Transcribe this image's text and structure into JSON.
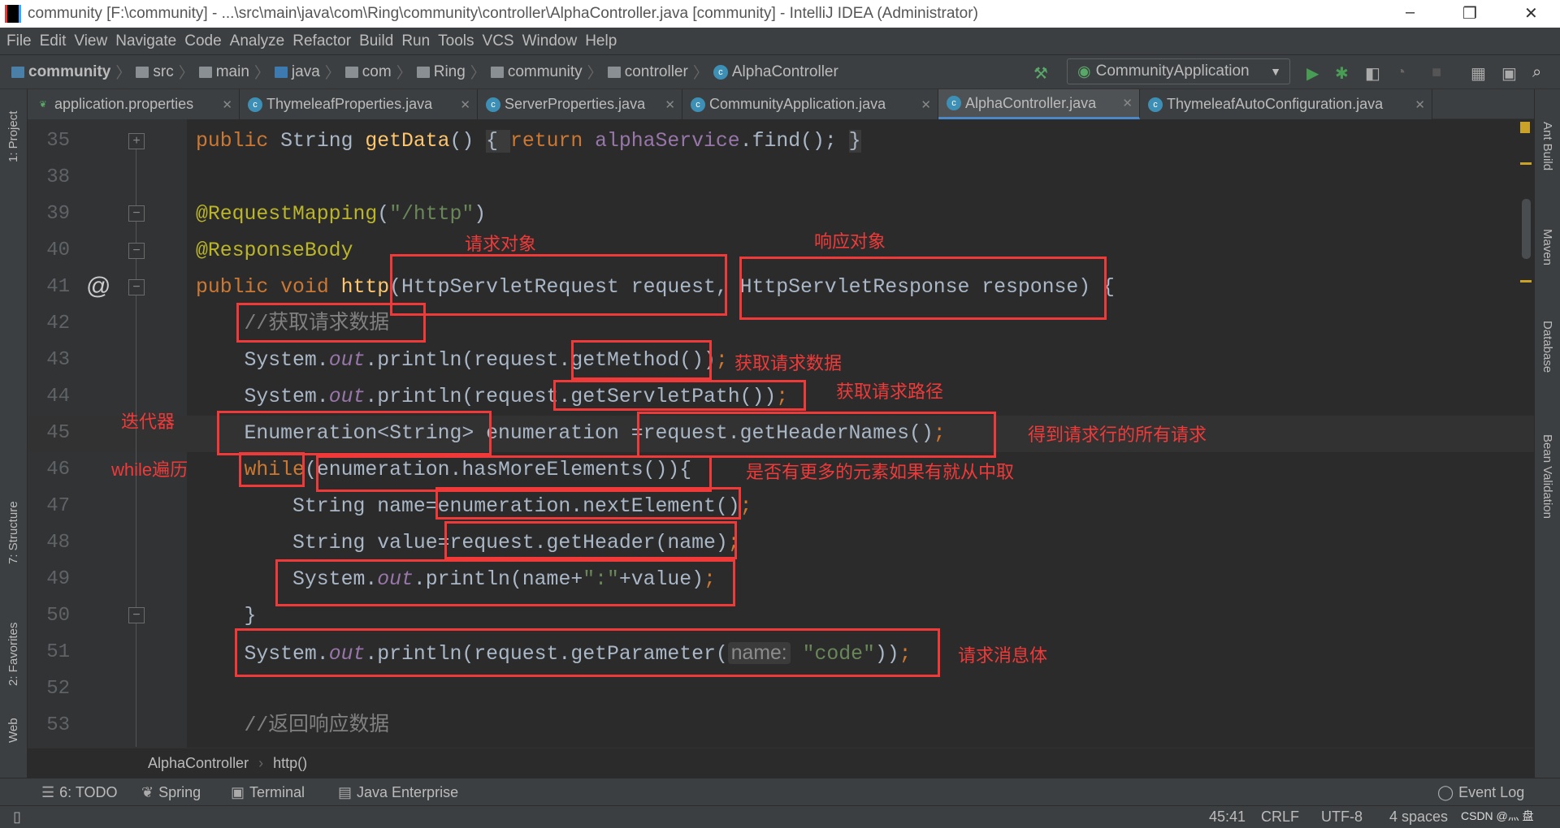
{
  "window": {
    "title": "community [F:\\community] - ...\\src\\main\\java\\com\\Ring\\community\\controller\\AlphaController.java [community] - IntelliJ IDEA (Administrator)",
    "minimize": "–",
    "maximize": "❐",
    "close": "✕"
  },
  "menu": [
    "File",
    "Edit",
    "View",
    "Navigate",
    "Code",
    "Analyze",
    "Refactor",
    "Build",
    "Run",
    "Tools",
    "VCS",
    "Window",
    "Help"
  ],
  "breadcrumb": [
    "community",
    "src",
    "main",
    "java",
    "com",
    "Ring",
    "community",
    "controller",
    "AlphaController"
  ],
  "run_config": {
    "label": "CommunityApplication",
    "arrow": "▼"
  },
  "toolbar_icons": [
    "hammer-icon",
    "run-icon",
    "debug-icon",
    "coverage-icon",
    "profile-icon",
    "stop-icon",
    "project-structure-icon",
    "presentation-icon",
    "search-icon"
  ],
  "tabs": [
    {
      "label": "application.properties",
      "active": false
    },
    {
      "label": "ThymeleafProperties.java",
      "active": false
    },
    {
      "label": "ServerProperties.java",
      "active": false
    },
    {
      "label": "CommunityApplication.java",
      "active": false
    },
    {
      "label": "AlphaController.java",
      "active": true
    },
    {
      "label": "ThymeleafAutoConfiguration.java",
      "active": false
    }
  ],
  "left_tools": [
    "1: Project",
    "7: Structure",
    "2: Favorites",
    "Web"
  ],
  "right_tools": [
    "Ant Build",
    "Maven",
    "Database",
    "Bean Validation"
  ],
  "line_numbers": [
    "35",
    "38",
    "39",
    "40",
    "41",
    "42",
    "43",
    "44",
    "45",
    "46",
    "47",
    "48",
    "49",
    "50",
    "51",
    "52",
    "53"
  ],
  "code": [
    [
      [
        "public ",
        "kw"
      ],
      [
        "String ",
        "pl"
      ],
      [
        "getData",
        "fn"
      ],
      [
        "() ",
        "pl"
      ],
      [
        "{ ",
        "brace"
      ],
      [
        "return ",
        "kw"
      ],
      [
        "alphaService",
        "st2"
      ],
      [
        ".find(); ",
        "pl"
      ],
      [
        "}",
        "brace"
      ]
    ],
    [],
    [
      [
        "@RequestMapping",
        "ann"
      ],
      [
        "(",
        "pl"
      ],
      [
        "\"/http\"",
        "str"
      ],
      [
        ")",
        "pl"
      ]
    ],
    [
      [
        "@ResponseBody",
        "ann"
      ]
    ],
    [
      [
        "public ",
        "kw"
      ],
      [
        "void ",
        "kw"
      ],
      [
        "http",
        "fn"
      ],
      [
        "(HttpServletRequest request, HttpServletResponse response) {",
        "pl"
      ]
    ],
    [
      [
        "    //获取请求数据",
        "cm"
      ]
    ],
    [
      [
        "    System.",
        "pl"
      ],
      [
        "out",
        "st"
      ],
      [
        ".println(request.getMethod())",
        "pl"
      ],
      [
        ";",
        "kw"
      ]
    ],
    [
      [
        "    System.",
        "pl"
      ],
      [
        "out",
        "st"
      ],
      [
        ".println(request.getServletPath())",
        "pl"
      ],
      [
        ";",
        "kw"
      ]
    ],
    [
      [
        "    Enumeration<String> enumeration =request.getHeaderNames()",
        "pl"
      ],
      [
        ";",
        "kw"
      ]
    ],
    [
      [
        "    ",
        "pl"
      ],
      [
        "while",
        "kw"
      ],
      [
        "(enumeration.hasMoreElements()){",
        "pl"
      ]
    ],
    [
      [
        "        String name=enumeration.nextElement()",
        "pl"
      ],
      [
        ";",
        "kw"
      ]
    ],
    [
      [
        "        String value=request.getHeader(name)",
        "pl"
      ],
      [
        ";",
        "kw"
      ]
    ],
    [
      [
        "        System.",
        "pl"
      ],
      [
        "out",
        "st"
      ],
      [
        ".println(name+",
        "pl"
      ],
      [
        "\":\"",
        "str"
      ],
      [
        "+value)",
        "pl"
      ],
      [
        ";",
        "kw"
      ]
    ],
    [
      [
        "    }",
        "pl"
      ]
    ],
    [
      [
        "    System.",
        "pl"
      ],
      [
        "out",
        "st"
      ],
      [
        ".println(request.getParameter(",
        "pl"
      ],
      [
        "name:",
        "hint"
      ],
      [
        " ",
        "pl"
      ],
      [
        "\"code\"",
        "str"
      ],
      [
        "))",
        "pl"
      ],
      [
        ";",
        "kw"
      ]
    ],
    [],
    [
      [
        "    //返回响应数据",
        "cm"
      ]
    ]
  ],
  "annotations": [
    "请求对象",
    "响应对象",
    "获取请求数据",
    "获取请求路径",
    "迭代器",
    "得到请求行的所有请求",
    "while遍历",
    "是否有更多的元素如果有就从中取",
    "请求消息体"
  ],
  "gutter_marker": "@",
  "editor_breadcrumb": [
    "AlphaController",
    "http()"
  ],
  "bottom_tools": [
    "6: TODO",
    "Spring",
    "Terminal",
    "Java Enterprise"
  ],
  "event_log": "Event Log",
  "status": {
    "position": "45:41",
    "line_sep": "CRLF",
    "encoding": "UTF-8",
    "indent": "4 spaces",
    "watermark": "CSDN @灬 盘"
  },
  "colors": {
    "keyword": "#CC7832",
    "function": "#FFC66D",
    "annotation": "#BBB529",
    "string": "#6A8759",
    "comment": "#808080",
    "static": "#9876AA",
    "highlight_box": "#F03A3A"
  }
}
